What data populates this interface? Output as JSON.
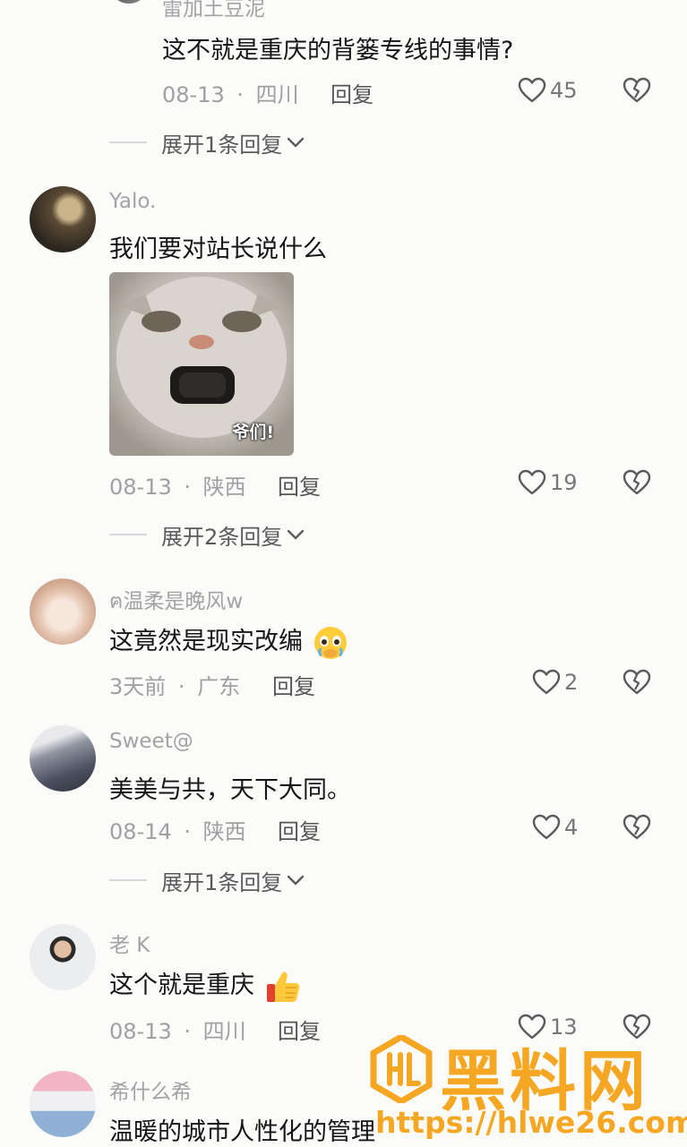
{
  "comments": [
    {
      "username": "雷加土豆泥",
      "text": "这不就是重庆的背篓专线的事情?",
      "date": "08-13",
      "location": "四川",
      "reply_label": "回复",
      "likes": "45",
      "expand_label": "展开1条回复"
    },
    {
      "username": "Yalo.",
      "text": "我们要对站长说什么",
      "image_caption": "爷们!",
      "date": "08-13",
      "location": "陕西",
      "reply_label": "回复",
      "likes": "19",
      "expand_label": "展开2条回复"
    },
    {
      "username": "ฅ温柔是晚风w",
      "text": "这竟然是现实改编",
      "date": "3天前",
      "location": "广东",
      "reply_label": "回复",
      "likes": "2"
    },
    {
      "username": "Sweet@",
      "text": "美美与共，天下大同。",
      "date": "08-14",
      "location": "陕西",
      "reply_label": "回复",
      "likes": "4",
      "expand_label": "展开1条回复"
    },
    {
      "username": "老 K",
      "text": "这个就是重庆",
      "date": "08-13",
      "location": "四川",
      "reply_label": "回复",
      "likes": "13"
    },
    {
      "username": "希什么希",
      "text": "温暖的城市人性化的管理"
    }
  ],
  "separator": "·",
  "watermark": {
    "brand": "黑料网",
    "url": "https://hlwe26.com",
    "color": "#f5a623"
  },
  "icons": {
    "like": "heart-outline-icon",
    "dislike": "broken-heart-icon",
    "expand": "chevron-down-icon"
  }
}
